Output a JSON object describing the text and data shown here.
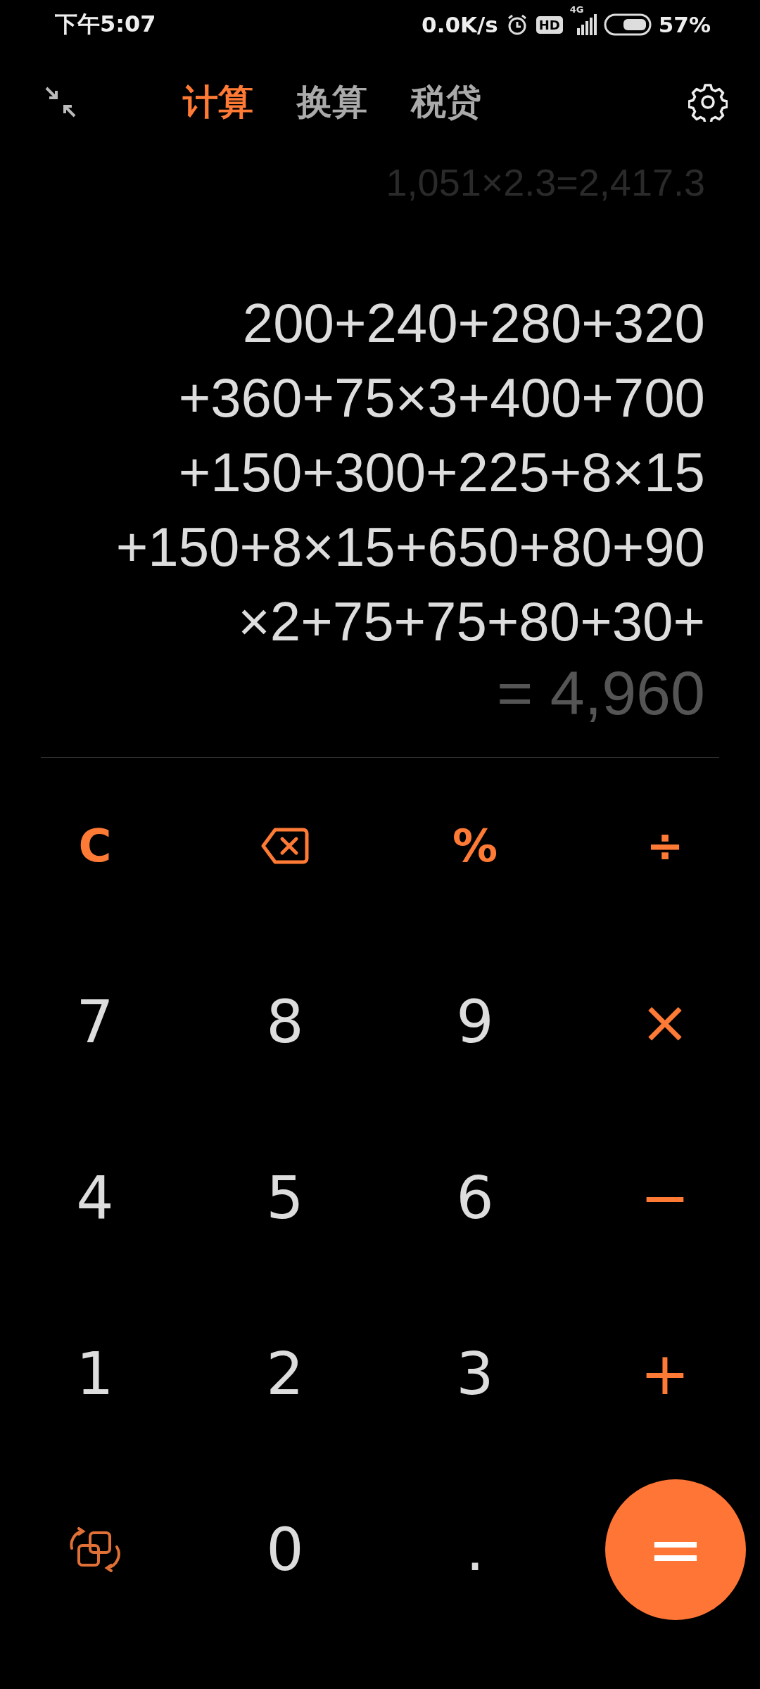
{
  "status_bar": {
    "time": "下午5:07",
    "net_speed": "0.0K/s",
    "hd": "HD",
    "network": "4G",
    "battery": "57%"
  },
  "tabs": [
    {
      "label": "计算",
      "selected": true
    },
    {
      "label": "换算",
      "selected": false
    },
    {
      "label": "税贷",
      "selected": false
    }
  ],
  "history": "1,051×2.3=2,417.3",
  "expression_lines": [
    "200+240+280+320",
    "+360+75×3+400+700",
    "+150+300+225+8×15",
    "+150+8×15+650+80+90",
    "×2+75+75+80+30+"
  ],
  "result": "= 4,960",
  "keys": [
    {
      "kind": "operator",
      "label": "C"
    },
    {
      "kind": "backspace"
    },
    {
      "kind": "operator",
      "label": "%"
    },
    {
      "kind": "operator",
      "label": "÷"
    },
    {
      "kind": "digit",
      "label": "7"
    },
    {
      "kind": "digit",
      "label": "8"
    },
    {
      "kind": "digit",
      "label": "9"
    },
    {
      "kind": "operator",
      "label": "×"
    },
    {
      "kind": "digit",
      "label": "4"
    },
    {
      "kind": "digit",
      "label": "5"
    },
    {
      "kind": "digit",
      "label": "6"
    },
    {
      "kind": "operator",
      "label": "−"
    },
    {
      "kind": "digit",
      "label": "1"
    },
    {
      "kind": "digit",
      "label": "2"
    },
    {
      "kind": "digit",
      "label": "3"
    },
    {
      "kind": "operator",
      "label": "+"
    },
    {
      "kind": "switch"
    },
    {
      "kind": "digit",
      "label": "0"
    },
    {
      "kind": "digit",
      "label": "."
    },
    {
      "kind": "equals",
      "label": "="
    }
  ]
}
